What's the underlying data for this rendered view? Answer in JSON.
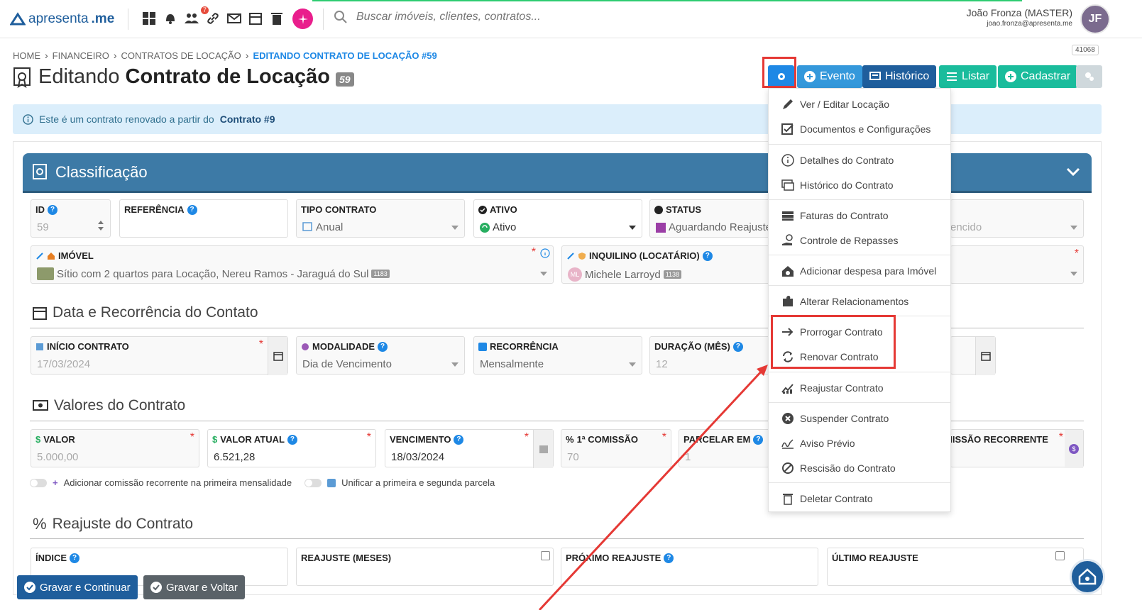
{
  "app": {
    "logo_text": "apresenta",
    "logo_suffix": ".me"
  },
  "topbar": {
    "notif_count": "7",
    "search_placeholder": "Buscar imóveis, clientes, contratos...",
    "user_name": "João Fronza (MASTER)",
    "user_email": "joao.fronza@apresenta.me",
    "avatar_initials": "JF"
  },
  "breadcrumb": {
    "items": [
      "HOME",
      "FINANCEIRO",
      "CONTRATOS DE LOCAÇÃO"
    ],
    "current": "EDITANDO CONTRATO DE LOCAÇÃO #59"
  },
  "record_id": "41068",
  "title": {
    "prefix": "Editando",
    "main": "Contrato de Locação",
    "number": "59"
  },
  "toolbar": {
    "evento": "Evento",
    "historico": "Histórico",
    "listar": "Listar",
    "cadastrar": "Cadastrar"
  },
  "info": {
    "text": "Este é um contrato renovado a partir do",
    "link": "Contrato #9"
  },
  "classificacao": {
    "title": "Classificação",
    "id_label": "ID",
    "id_value": "59",
    "ref_label": "REFERÊNCIA",
    "ref_value": "",
    "tipo_label": "TIPO CONTRATO",
    "tipo_value": "Anual",
    "ativo_label": "ATIVO",
    "ativo_value": "Ativo",
    "status_label": "STATUS",
    "status_value": "Aguardando Reajuste",
    "venc_value": "encido",
    "imovel_label": "IMÓVEL",
    "imovel_value": "Sítio com 2 quartos para Locação, Nereu Ramos - Jaraguá do Sul",
    "imovel_badge": "1183",
    "inquilino_label": "INQUILINO (LOCATÁRIO)",
    "inquilino_value": "Michele Larroyd",
    "inquilino_badge": "1138",
    "inquilino_initials": "ML"
  },
  "data_recorrencia": {
    "title": "Data e Recorrência do Contato",
    "inicio_label": "INÍCIO CONTRATO",
    "inicio_value": "17/03/2024",
    "modalidade_label": "MODALIDADE",
    "modalidade_value": "Dia de Vencimento",
    "recorrencia_label": "RECORRÊNCIA",
    "recorrencia_value": "Mensalmente",
    "duracao_label": "DURAÇÃO (MÊS)",
    "duracao_value": "12"
  },
  "valores": {
    "title": "Valores do Contrato",
    "valor_label": "VALOR",
    "valor_value": "5.000,00",
    "atual_label": "VALOR ATUAL",
    "atual_value": "6.521,28",
    "venc_label": "VENCIMENTO",
    "venc_value": "18/03/2024",
    "comissao_label": "1ª COMISSÃO",
    "comissao_value": "70",
    "parcelar_label": "PARCELAR EM",
    "parcelar_value": "1",
    "recorrente_label": "MISSÃO RECORRENTE",
    "toggle1": "Adicionar comissão recorrente na primeira mensalidade",
    "toggle2": "Unificar a primeira e segunda parcela"
  },
  "reajuste": {
    "title": "Reajuste do Contrato",
    "indice_label": "ÍNDICE",
    "meses_label": "REAJUSTE (MESES)",
    "proximo_label": "PRÓXIMO REAJUSTE",
    "ultimo_label": "ÚLTIMO REAJUSTE"
  },
  "menu": {
    "items": [
      "Ver / Editar Locação",
      "Documentos e Configurações",
      "Detalhes do Contrato",
      "Histórico do Contrato",
      "Faturas do Contrato",
      "Controle de Repasses",
      "Adicionar despesa para Imóvel",
      "Alterar Relacionamentos",
      "Prorrogar Contrato",
      "Renovar Contrato",
      "Reajustar Contrato",
      "Suspender Contrato",
      "Aviso Prévio",
      "Rescisão do Contrato",
      "Deletar Contrato"
    ]
  },
  "footer": {
    "gravar_continuar": "Gravar e Continuar",
    "gravar_voltar": "Gravar e Voltar"
  },
  "colors": {
    "primary": "#1e88e5",
    "historico": "#1f5e9c",
    "teal": "#1abc9c",
    "section": "#3d7aa6",
    "highlight": "#e53935"
  }
}
